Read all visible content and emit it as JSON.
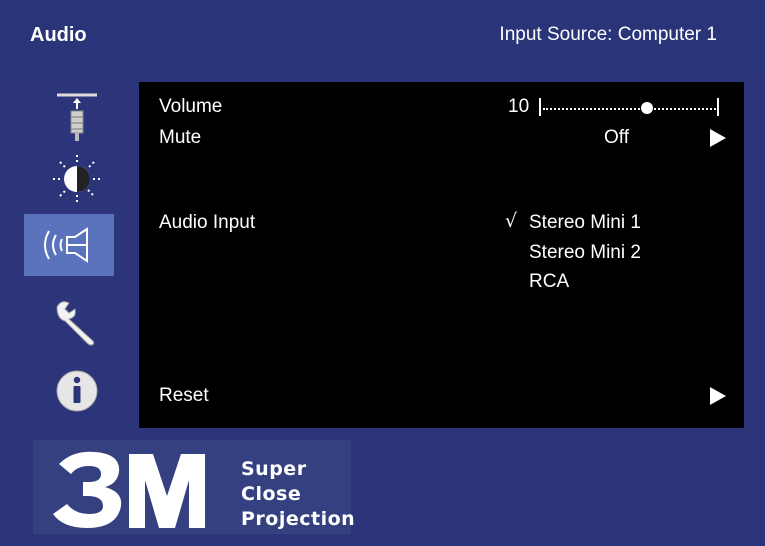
{
  "header": {
    "title": "Audio",
    "input_source": "Input Source: Computer 1"
  },
  "sidebar": {
    "items": [
      {
        "icon": "projector-lamp-icon",
        "selected": false
      },
      {
        "icon": "brightness-icon",
        "selected": false
      },
      {
        "icon": "audio-speaker-icon",
        "selected": true
      },
      {
        "icon": "wrench-icon",
        "selected": false
      },
      {
        "icon": "info-icon",
        "selected": false
      }
    ]
  },
  "menu": {
    "volume": {
      "label": "Volume",
      "value": "10",
      "level": 0.6
    },
    "mute": {
      "label": "Mute",
      "value": "Off"
    },
    "audio_input": {
      "label": "Audio Input",
      "check_mark": "√",
      "options": [
        "Stereo Mini 1",
        "Stereo Mini 2",
        "RCA"
      ],
      "selected_index": 0
    },
    "reset": {
      "label": "Reset"
    }
  },
  "logo": {
    "brand": "3M",
    "line1": "Super",
    "line2": "Close",
    "line3": "Projection"
  },
  "colors": {
    "background": "#2c3579",
    "panel": "#000000",
    "selected_item": "#5b73bd"
  }
}
